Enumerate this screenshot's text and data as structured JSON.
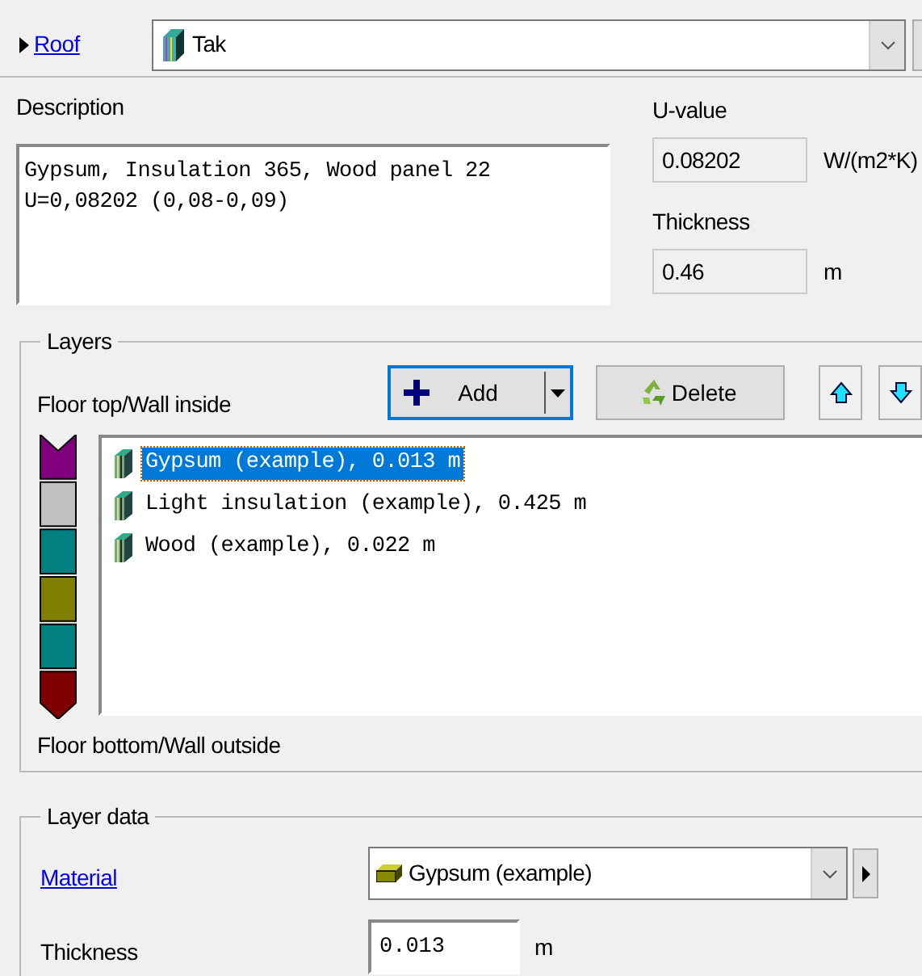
{
  "construction": {
    "link": "Roof",
    "value": "Tak"
  },
  "description": {
    "label": "Description",
    "lines": [
      "Gypsum, Insulation 365, Wood panel 22",
      "U=0,08202 (0,08-0,09)"
    ]
  },
  "u_value": {
    "label": "U-value",
    "value": "0.08202",
    "unit": "W/(m2*K)"
  },
  "thickness": {
    "label": "Thickness",
    "value": "0.46",
    "unit": "m"
  },
  "layers": {
    "legend": "Layers",
    "top_label": "Floor top/Wall inside",
    "bottom_label": "Floor bottom/Wall outside",
    "buttons": [
      {
        "kind": "add",
        "label": "Add"
      },
      {
        "kind": "delete",
        "label": "Delete"
      },
      {
        "kind": "up"
      },
      {
        "kind": "down"
      }
    ],
    "stack": [
      {
        "color": "#800080"
      },
      {
        "color": "#c0c0c0"
      },
      {
        "color": "#008080"
      },
      {
        "color": "#808000"
      },
      {
        "color": "#008080"
      },
      {
        "color": "#800000"
      }
    ],
    "items": [
      {
        "label": "Gypsum (example), 0.013 m",
        "selected": true
      },
      {
        "label": "Light insulation (example), 0.425 m",
        "selected": false
      },
      {
        "label": "Wood (example), 0.022 m",
        "selected": false
      }
    ]
  },
  "layer_data": {
    "legend": "Layer data",
    "material_link": "Material",
    "material_value": "Gypsum (example)",
    "thickness_label": "Thickness",
    "thickness_value": "0.013",
    "thickness_unit": "m"
  }
}
